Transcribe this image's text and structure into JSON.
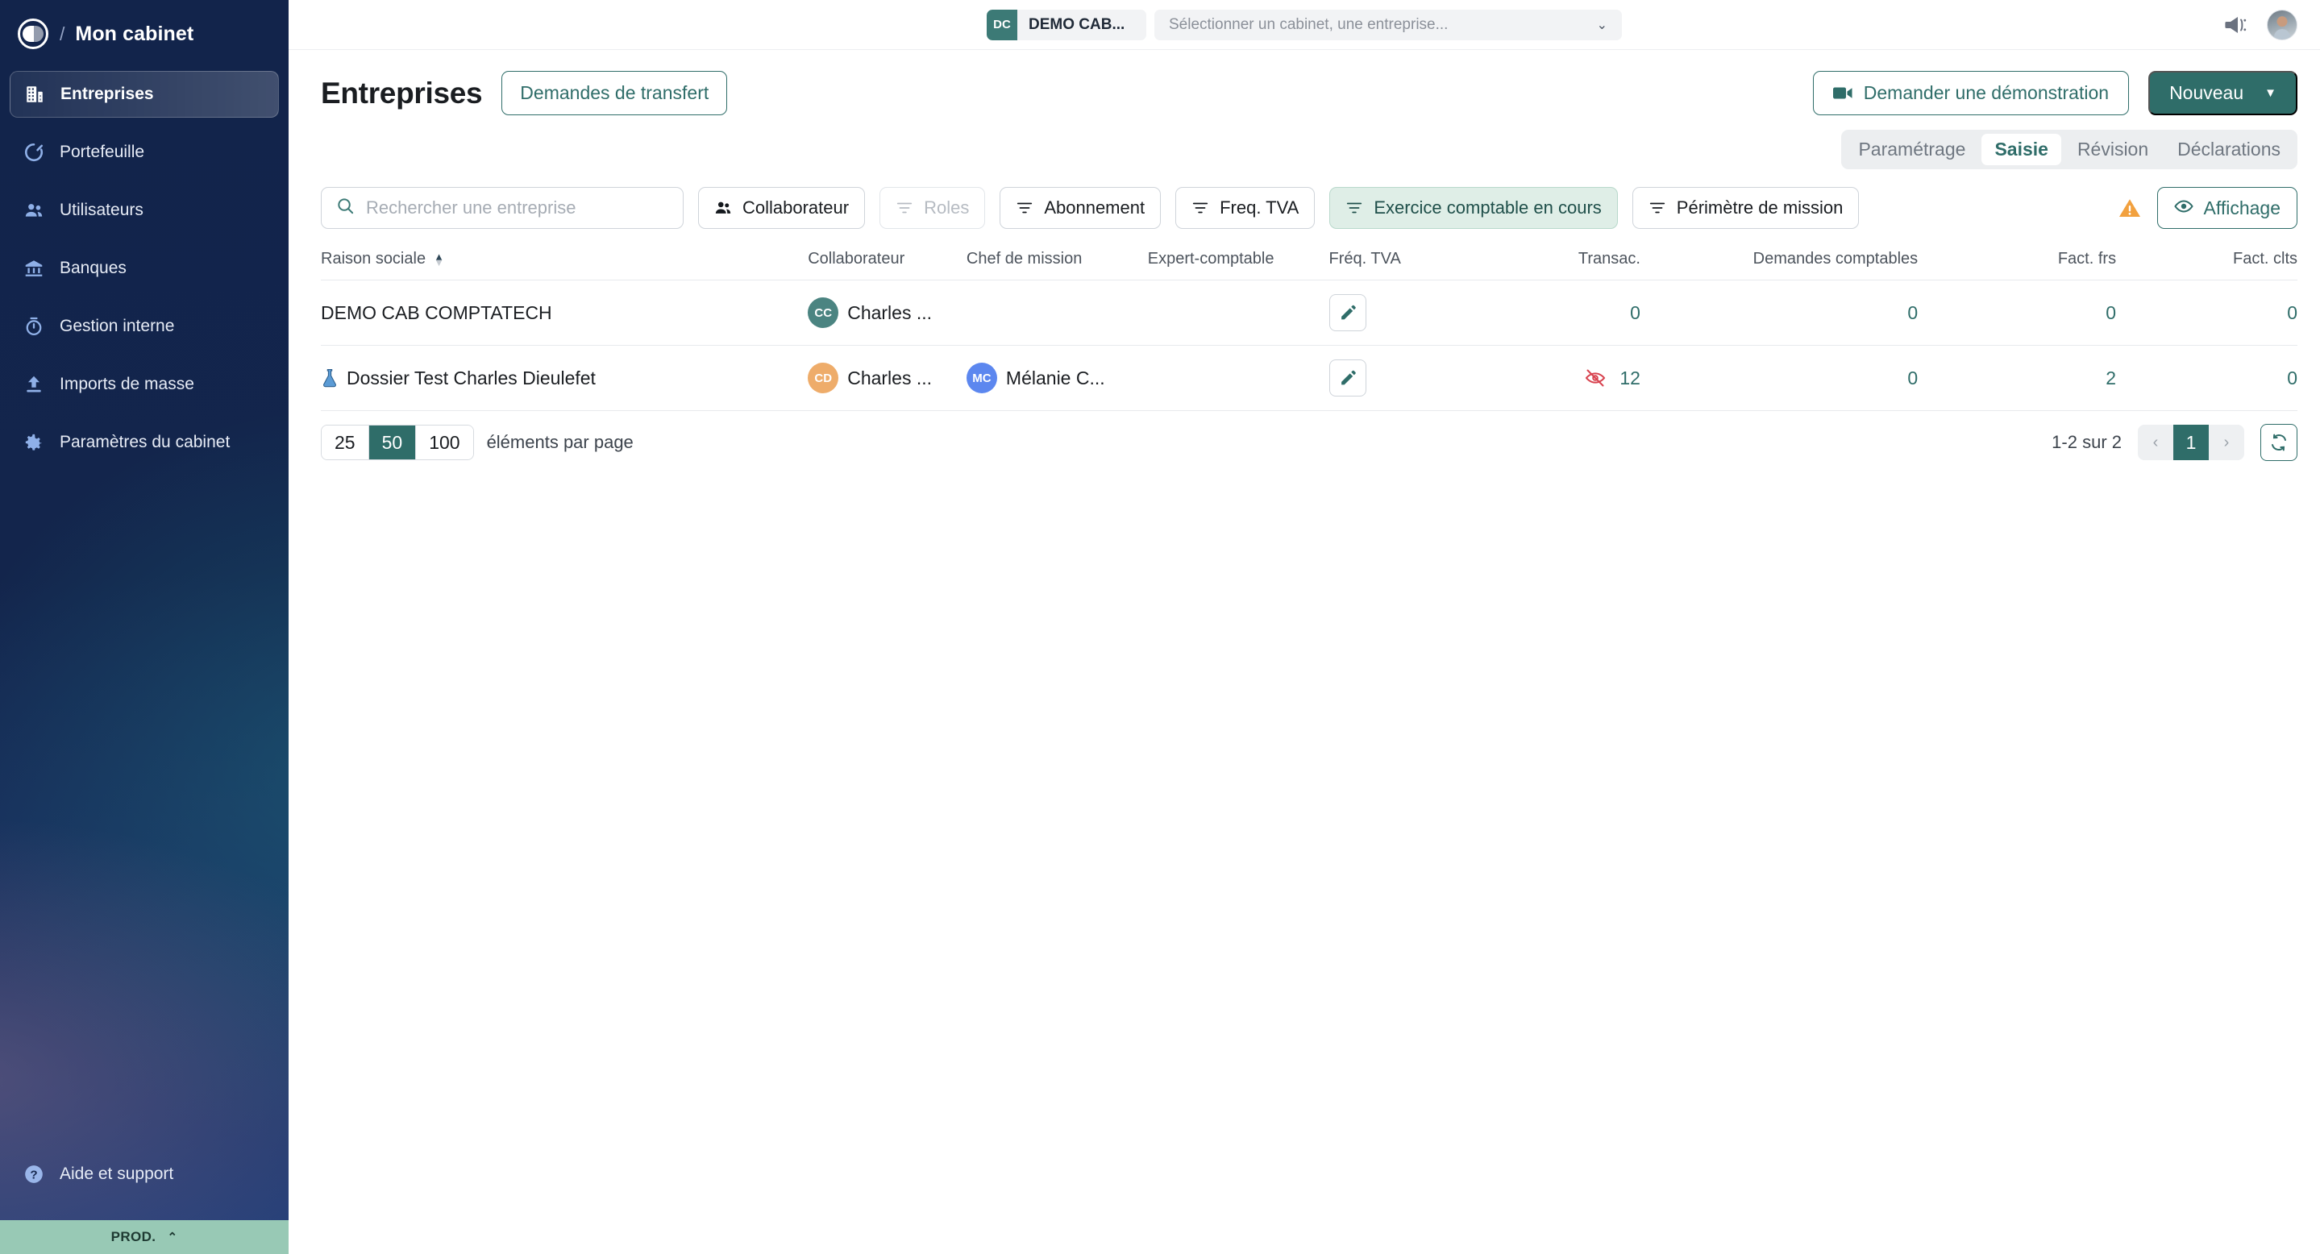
{
  "sidebar": {
    "brand": {
      "slash": "/",
      "title": "Mon cabinet",
      "logo_icon": "app-logo-icon"
    },
    "items": [
      {
        "label": "Entreprises",
        "icon": "building-icon",
        "active": true
      },
      {
        "label": "Portefeuille",
        "icon": "donut-chart-icon",
        "active": false
      },
      {
        "label": "Utilisateurs",
        "icon": "users-icon",
        "active": false
      },
      {
        "label": "Banques",
        "icon": "bank-icon",
        "active": false
      },
      {
        "label": "Gestion interne",
        "icon": "stopwatch-icon",
        "active": false
      },
      {
        "label": "Imports de masse",
        "icon": "upload-icon",
        "active": false
      },
      {
        "label": "Paramètres du cabinet",
        "icon": "gear-icon",
        "active": false
      }
    ],
    "help": {
      "label": "Aide et support",
      "icon": "question-circle-icon"
    },
    "footer": {
      "label": "PROD.",
      "chevron": "⌃"
    },
    "colors": {
      "bg_top": "#12244b",
      "bg_bottom": "#24407a",
      "footer_bg": "#98c9b5"
    }
  },
  "topbar": {
    "cabinet_chip": {
      "initials": "DC",
      "label": "DEMO CAB...",
      "badge_color": "#3c7a76"
    },
    "selector": {
      "placeholder": "Sélectionner un cabinet, une entreprise...",
      "chevron": "⌄"
    },
    "megaphone_icon": "megaphone-icon",
    "avatar": "user-avatar"
  },
  "header": {
    "title": "Entreprises",
    "transfer_button": "Demandes de transfert",
    "demo_button": "Demander une démonstration",
    "new_button": "Nouveau",
    "new_caret": "▼"
  },
  "tabs": [
    {
      "label": "Paramétrage",
      "active": false
    },
    {
      "label": "Saisie",
      "active": true
    },
    {
      "label": "Révision",
      "active": false
    },
    {
      "label": "Déclarations",
      "active": false
    }
  ],
  "toolbar": {
    "search_placeholder": "Rechercher une entreprise",
    "search_value": "",
    "filters": [
      {
        "label": "Collaborateur",
        "icon": "users-icon",
        "state": "normal"
      },
      {
        "label": "Roles",
        "icon": "filter-icon",
        "state": "disabled"
      },
      {
        "label": "Abonnement",
        "icon": "filter-icon",
        "state": "normal"
      },
      {
        "label": "Freq. TVA",
        "icon": "filter-icon",
        "state": "normal"
      },
      {
        "label": "Exercice comptable en cours",
        "icon": "filter-icon",
        "state": "active"
      },
      {
        "label": "Périmètre de mission",
        "icon": "filter-icon",
        "state": "normal"
      }
    ],
    "warning_icon": "warning-triangle-icon",
    "display_button": "Affichage",
    "display_icon": "eye-icon"
  },
  "table": {
    "columns": [
      {
        "key": "raison_sociale",
        "label": "Raison sociale",
        "sortable": true,
        "sort": "asc",
        "align": "left"
      },
      {
        "key": "collaborateur",
        "label": "Collaborateur",
        "align": "left"
      },
      {
        "key": "chef_mission",
        "label": "Chef de mission",
        "align": "left"
      },
      {
        "key": "expert_comptable",
        "label": "Expert-comptable",
        "align": "left"
      },
      {
        "key": "freq_tva",
        "label": "Fréq. TVA",
        "align": "left"
      },
      {
        "key": "transac",
        "label": "Transac.",
        "align": "right"
      },
      {
        "key": "demandes_comptables",
        "label": "Demandes comptables",
        "align": "right"
      },
      {
        "key": "fact_frs",
        "label": "Fact. frs",
        "align": "right"
      },
      {
        "key": "fact_clts",
        "label": "Fact. clts",
        "align": "right"
      }
    ],
    "rows": [
      {
        "raison_sociale": "DEMO CAB COMPTATECH",
        "has_flask": false,
        "collaborateur": {
          "initials": "CC",
          "name": "Charles ...",
          "color": "#4b8481"
        },
        "chef_mission": null,
        "expert_comptable": null,
        "freq_tva_icon": "pencil-icon",
        "eye_off": false,
        "transac": "0",
        "demandes_comptables": "0",
        "fact_frs": "0",
        "fact_clts": "0"
      },
      {
        "raison_sociale": "Dossier Test Charles Dieulefet",
        "has_flask": true,
        "collaborateur": {
          "initials": "CD",
          "name": "Charles ...",
          "color": "#eeac6a"
        },
        "chef_mission": {
          "initials": "MC",
          "name": "Mélanie C...",
          "color": "#5c87ef"
        },
        "expert_comptable": null,
        "freq_tva_icon": "pencil-icon",
        "eye_off": true,
        "transac": "12",
        "demandes_comptables": "0",
        "fact_frs": "2",
        "fact_clts": "0"
      }
    ]
  },
  "pagination": {
    "per_page_options": [
      {
        "label": "25",
        "active": false
      },
      {
        "label": "50",
        "active": true
      },
      {
        "label": "100",
        "active": false
      }
    ],
    "per_page_label": "éléments par page",
    "range": "1-2 sur 2",
    "prev": "‹",
    "current_page": "1",
    "next": "›",
    "refresh_icon": "refresh-icon"
  },
  "colors": {
    "accent": "#2f6d69",
    "sidebar": "#12244b",
    "danger": "#d8434f",
    "warning": "#f2a13f"
  }
}
